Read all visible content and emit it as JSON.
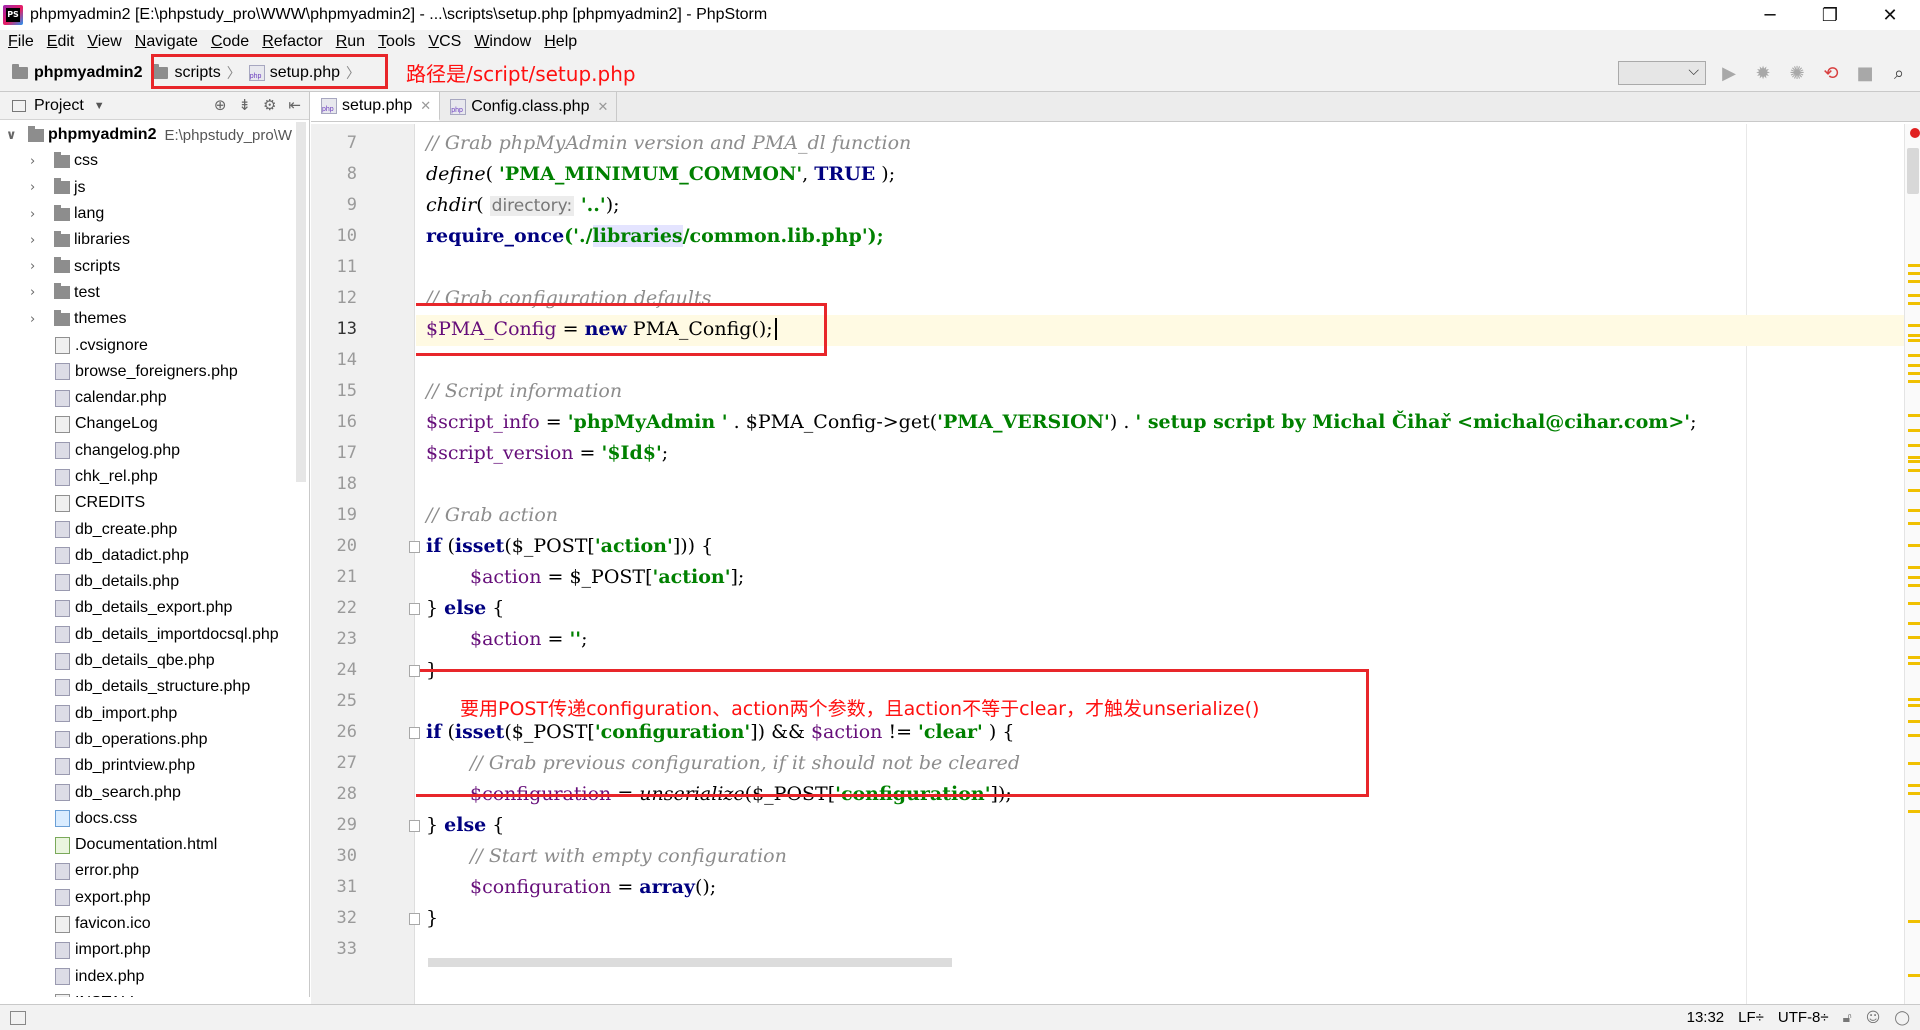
{
  "window": {
    "title": "phpmyadmin2 [E:\\phpstudy_pro\\WWW\\phpmyadmin2] - ...\\scripts\\setup.php [phpmyadmin2] - PhpStorm",
    "minimize": "─",
    "maximize": "❐",
    "close": "✕"
  },
  "menu": [
    "File",
    "Edit",
    "View",
    "Navigate",
    "Code",
    "Refactor",
    "Run",
    "Tools",
    "VCS",
    "Window",
    "Help"
  ],
  "navbar": {
    "root": "phpmyadmin2",
    "crumbs": [
      "scripts",
      "setup.php"
    ],
    "annotation": "路径是/script/setup.php"
  },
  "project": {
    "title": "Project",
    "root": {
      "name": "phpmyadmin2",
      "path": "E:\\phpstudy_pro\\W"
    },
    "folders": [
      "css",
      "js",
      "lang",
      "libraries",
      "scripts",
      "test",
      "themes"
    ],
    "files": [
      {
        "name": ".cvsignore",
        "type": "txt"
      },
      {
        "name": "browse_foreigners.php",
        "type": "php"
      },
      {
        "name": "calendar.php",
        "type": "php"
      },
      {
        "name": "ChangeLog",
        "type": "txt"
      },
      {
        "name": "changelog.php",
        "type": "php"
      },
      {
        "name": "chk_rel.php",
        "type": "php"
      },
      {
        "name": "CREDITS",
        "type": "txt"
      },
      {
        "name": "db_create.php",
        "type": "php"
      },
      {
        "name": "db_datadict.php",
        "type": "php"
      },
      {
        "name": "db_details.php",
        "type": "php"
      },
      {
        "name": "db_details_export.php",
        "type": "php"
      },
      {
        "name": "db_details_importdocsql.php",
        "type": "php"
      },
      {
        "name": "db_details_qbe.php",
        "type": "php"
      },
      {
        "name": "db_details_structure.php",
        "type": "php"
      },
      {
        "name": "db_import.php",
        "type": "php"
      },
      {
        "name": "db_operations.php",
        "type": "php"
      },
      {
        "name": "db_printview.php",
        "type": "php"
      },
      {
        "name": "db_search.php",
        "type": "php"
      },
      {
        "name": "docs.css",
        "type": "css"
      },
      {
        "name": "Documentation.html",
        "type": "html"
      },
      {
        "name": "error.php",
        "type": "php"
      },
      {
        "name": "export.php",
        "type": "php"
      },
      {
        "name": "favicon.ico",
        "type": "txt"
      },
      {
        "name": "import.php",
        "type": "php"
      },
      {
        "name": "index.php",
        "type": "php"
      },
      {
        "name": "INSTALL",
        "type": "txt"
      }
    ]
  },
  "tabs": [
    {
      "label": "setup.php",
      "active": true
    },
    {
      "label": "Config.class.php",
      "active": false
    }
  ],
  "editor": {
    "line_numbers": [
      "7",
      "8",
      "9",
      "10",
      "11",
      "12",
      "13",
      "14",
      "15",
      "16",
      "17",
      "18",
      "19",
      "20",
      "21",
      "22",
      "23",
      "24",
      "25",
      "26",
      "27",
      "28",
      "29",
      "30",
      "31",
      "32",
      "33"
    ],
    "current_line": "13",
    "code": {
      "l7": "// Grab phpMyAdmin version and PMA_dl function",
      "l8_fn": "define",
      "l8_open": "( ",
      "l8_str": "'PMA_MINIMUM_COMMON'",
      "l8_sep": ", ",
      "l8_kw": "TRUE",
      "l8_close": " );",
      "l9_fn": "chdir",
      "l9_open": "( ",
      "l9_hint": "directory:",
      "l9_str": " '..'",
      "l9_close": ");",
      "l10_kw": "require_once",
      "l10_open": "('./",
      "l10_hl": "libraries",
      "l10_rest": "/common.lib.php');",
      "l12": "// Grab configuration defaults",
      "l13_var": "$PMA_Config",
      "l13_eq": " = ",
      "l13_kw": "new",
      "l13_rest": " PMA_Config();",
      "l15": "// Script information",
      "l16_var": "$script_info",
      "l16_eq": " = ",
      "l16_str": "'phpMyAdmin '",
      "l16_mid": " . $PMA_Config->get(",
      "l16_str2": "'PMA_VERSION'",
      "l16_mid2": ") . ",
      "l16_str3": "' setup script by Michal Čihař <michal@cihar.com>'",
      "l16_end": ";",
      "l17_var": "$script_version",
      "l17_eq": " = ",
      "l17_str": "'$Id$'",
      "l17_end": ";",
      "l19": "// Grab action",
      "l20_kw": "if",
      "l20_a": " (",
      "l20_kw2": "isset",
      "l20_b": "($_POST[",
      "l20_str": "'action'",
      "l20_c": "])) {",
      "l21_var": "$action",
      "l21_a": " = $_POST[",
      "l21_str": "'action'",
      "l21_b": "];",
      "l22_a": "} ",
      "l22_kw": "else",
      "l22_b": " {",
      "l23_var": "$action",
      "l23_a": " = ",
      "l23_str": "''",
      "l23_b": ";",
      "l24": "}",
      "l26_kw": "if",
      "l26_a": " (",
      "l26_kw2": "isset",
      "l26_b": "($_POST[",
      "l26_str": "'configuration'",
      "l26_c": "]) && ",
      "l26_var": "$action",
      "l26_d": " != ",
      "l26_str2": "'clear'",
      "l26_e": " ) {",
      "l27": "// Grab previous configuration, if it should not be cleared",
      "l28_var": "$configuration",
      "l28_a": " = ",
      "l28_fn": "unserialize",
      "l28_b": "($_POST[",
      "l28_str": "'configuration'",
      "l28_c": "]);",
      "l29_a": "} ",
      "l29_kw": "else",
      "l29_b": " {",
      "l30": "// Start with empty configuration",
      "l31_var": "$configuration",
      "l31_a": " = ",
      "l31_kw": "array",
      "l31_b": "();",
      "l32": "}"
    },
    "annotation": "要用POST传递configuration、action两个参数，且action不等于clear，才触发unserialize()"
  },
  "status": {
    "position": "13:32",
    "line_sep": "LF÷",
    "encoding": "UTF-8÷"
  },
  "colors": {
    "annotation_red": "#e8262a",
    "keyword": "#000080",
    "string": "#008000",
    "comment": "#8c8c8c"
  }
}
